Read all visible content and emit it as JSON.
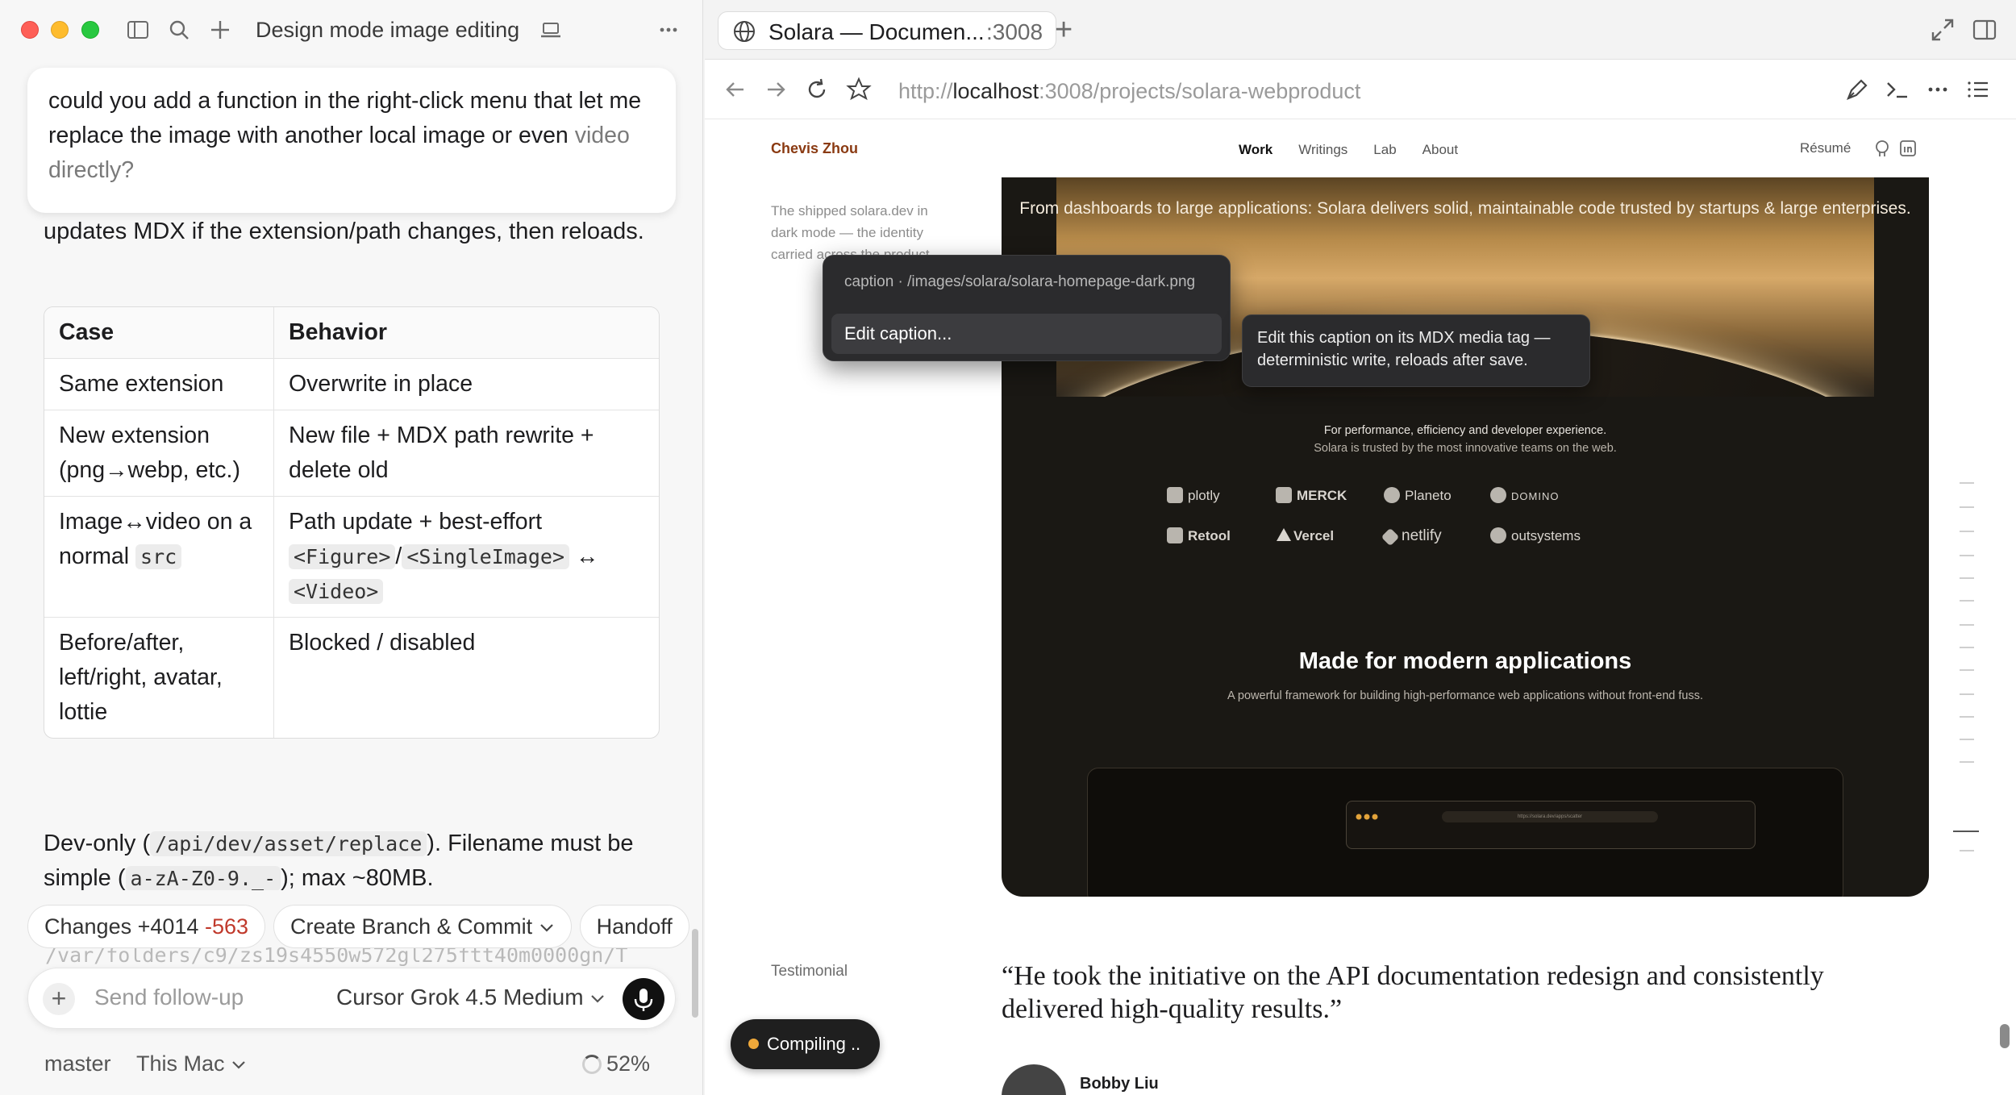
{
  "left": {
    "title": "Design mode image editing",
    "user_message_main": "could you add a function in the right-click menu that let me replace the image with another local image or even",
    "user_message_faded": "video directly?",
    "answer_intro": "updates MDX if the extension/path changes, then reloads.",
    "table": {
      "headers": [
        "Case",
        "Behavior"
      ],
      "rows": [
        {
          "case": "Same extension",
          "behavior": "Overwrite in place"
        },
        {
          "case": "New extension (png→webp, etc.)",
          "behavior": "New file + MDX path rewrite + delete old"
        },
        {
          "case_prefix": "Image↔video on a normal ",
          "case_code": "src",
          "behavior_prefix": "Path update + best-effort ",
          "behavior_code1": "<Figure>",
          "behavior_sep": "/",
          "behavior_code2": "<SingleImage>",
          "behavior_arrow": " ↔ ",
          "behavior_code3": "<Video>"
        },
        {
          "case": "Before/after, left/right, avatar, lottie",
          "behavior": "Blocked / disabled"
        }
      ]
    },
    "devonly": {
      "p1": "Dev-only (",
      "code1": "/api/dev/asset/replace",
      "p2": "). Filename must be simple (",
      "code2": "a-zA-Z0-9._-",
      "p3": "); max ~80MB."
    },
    "chips": {
      "changes_label": "Changes",
      "additions": "+4014",
      "deletions": "-563",
      "branch_commit": "Create Branch & Commit",
      "handoff": "Handoff"
    },
    "path_peek": "/var/folders/c9/zs19s4550w572gl275ftt40m0000gn/T",
    "composer": {
      "placeholder": "Send follow-up",
      "model": "Cursor Grok 4.5 Medium"
    },
    "status": {
      "branch": "master",
      "machine": "This Mac",
      "progress": "52%"
    }
  },
  "browser": {
    "tab_title": "Solara — Documen...",
    "tab_port": ":3008",
    "url_scheme": "http://",
    "url_host": "localhost",
    "url_rest": ":3008/projects/solara-webproduct"
  },
  "site": {
    "name": "Chevis Zhou",
    "nav": [
      "Work",
      "Writings",
      "Lab",
      "About"
    ],
    "resume": "Résumé",
    "side_caption": "The shipped solara.dev in dark mode — the identity carried across the product",
    "hero_sub": "From dashboards to large applications: Solara delivers solid, maintainable code trusted by startups & large enterprises.",
    "trust_line1": "For performance, efficiency and developer experience.",
    "trust_line2": "Solara is trusted by the most innovative teams on the web.",
    "logos_row1": [
      "plotly",
      "MERCK",
      "Planeto",
      "DOMINO"
    ],
    "logos_row2": [
      "Retool",
      "Vercel",
      "netlify",
      "outsystems"
    ],
    "made_title": "Made for modern applications",
    "made_sub": "A powerful framework for building high-performance web applications without front-end fuss.",
    "mini_url": "https://solara.dev/apps/scatter",
    "testimonial_label": "Testimonial",
    "quote": "“He took the initiative on the API documentation redesign and consistently delivered high-quality results.”",
    "author": "Bobby Liu",
    "compiling": "Compiling"
  },
  "context_menu": {
    "path": "caption · /images/solara/solara-homepage-dark.png",
    "item": "Edit caption...",
    "tooltip": "Edit this caption on its MDX media tag — deterministic write, reloads after save."
  },
  "colors": {
    "accent_brand": "#8a3a12",
    "deletions": "#c0392b",
    "compiling_dot": "#f0a93a"
  }
}
